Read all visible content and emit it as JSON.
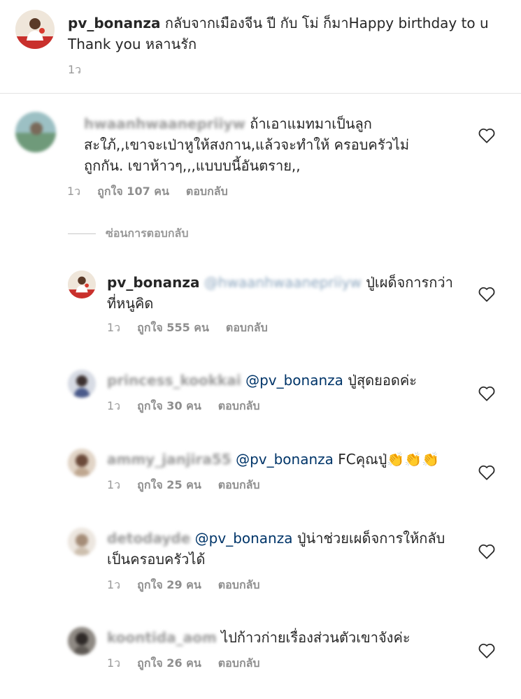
{
  "caption": {
    "username": "pv_bonanza",
    "text": "กลับจากเมืองจีน ปี กับ โม่ ก็มาHappy birthday to u Thank you หลานรัก",
    "time": "1ว"
  },
  "comments": [
    {
      "username": "hwaanhwaanepriiyw",
      "text": "ถ้าเอาแมทมาเป็นลูกสะใภ้,,เขาจะเป่าหูให้สงกาน,แล้วจะทำให้ ครอบครัวไม่ถูกกัน.  เขาห้าวๆ,,,แบบบนี้อันตราย,,",
      "time": "1ว",
      "likes": "ถูกใจ 107 คน",
      "reply": "ตอบกลับ"
    }
  ],
  "hide_replies": "ซ่อนการตอบกลับ",
  "replies": [
    {
      "username": "pv_bonanza",
      "mention": "@hwaanhwaanepriiyw",
      "text": "ปู่เผด็จการกว่าที่หนูคิด",
      "time": "1ว",
      "likes": "ถูกใจ 555 คน",
      "reply": "ตอบกลับ"
    },
    {
      "username": "princess_kookkai",
      "mention": "@pv_bonanza",
      "text": "ปู่สุดยอดค่ะ",
      "time": "1ว",
      "likes": "ถูกใจ 30 คน",
      "reply": "ตอบกลับ"
    },
    {
      "username": "ammy_janjira55",
      "mention": "@pv_bonanza",
      "text": "FCคุณปู่👏👏👏",
      "time": "1ว",
      "likes": "ถูกใจ 25 คน",
      "reply": "ตอบกลับ"
    },
    {
      "username": "detodayde",
      "mention": "@pv_bonanza",
      "text": "ปู่น่าช่วยเผด็จการให้กลับเป็นครอบครัวได้",
      "time": "1ว",
      "likes": "ถูกใจ 29 คน",
      "reply": "ตอบกลับ"
    },
    {
      "username": "koontida_aom",
      "mention": "",
      "text": "ไปก้าวก่ายเรื่องส่วนตัวเขาจังค่ะ",
      "time": "1ว",
      "likes": "ถูกใจ 26 คน",
      "reply": "ตอบกลับ"
    }
  ],
  "colors": {
    "text": "#262626",
    "muted": "#999999",
    "mention": "#003569",
    "divider": "#e3e3e3"
  },
  "icons": {
    "like": "heart-outline-icon",
    "owner_avatar": "avatar-man-red-shirt"
  }
}
